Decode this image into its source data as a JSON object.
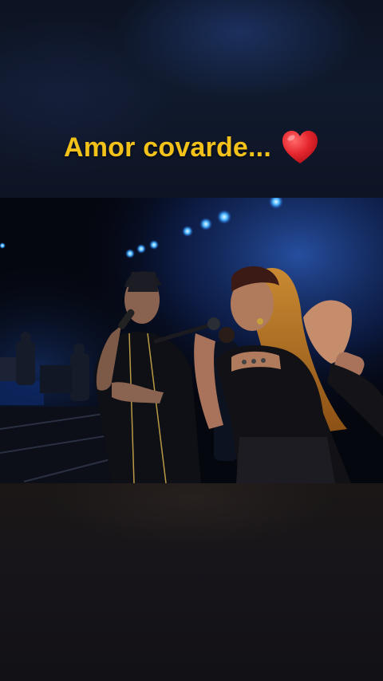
{
  "caption": {
    "text": "Amor covarde...",
    "emoji_icon": "red-heart-icon",
    "text_color": "#f2c21b",
    "heart_color": "#e5262e"
  },
  "video": {
    "scene": "live-concert-duet",
    "accent_light_color": "#3aa9ff"
  }
}
